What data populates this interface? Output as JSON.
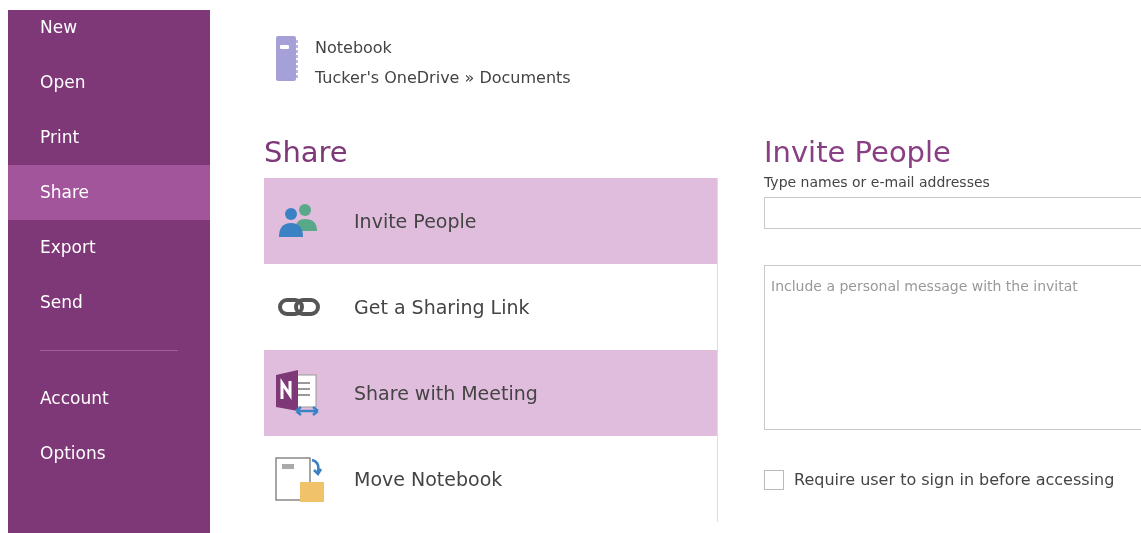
{
  "sidebar": {
    "items": [
      {
        "label": "New",
        "selected": false
      },
      {
        "label": "Open",
        "selected": false
      },
      {
        "label": "Print",
        "selected": false
      },
      {
        "label": "Share",
        "selected": true
      },
      {
        "label": "Export",
        "selected": false
      },
      {
        "label": "Send",
        "selected": false
      },
      {
        "kind": "divider"
      },
      {
        "label": "Account",
        "selected": false
      },
      {
        "label": "Options",
        "selected": false
      }
    ]
  },
  "notebook": {
    "name": "Notebook",
    "location": "Tucker's OneDrive » Documents"
  },
  "share": {
    "title": "Share",
    "options": [
      {
        "kind": "people",
        "label": "Invite People",
        "highlighted": true
      },
      {
        "kind": "link",
        "label": "Get a Sharing Link",
        "highlighted": false
      },
      {
        "kind": "meeting",
        "label": "Share with Meeting",
        "highlighted": true
      },
      {
        "kind": "move",
        "label": "Move Notebook",
        "highlighted": false
      }
    ]
  },
  "invite": {
    "title": "Invite People",
    "names_label": "Type names or e-mail addresses",
    "message": {
      "placeholder": "Include a personal message with the invitat"
    },
    "require_sign_in": {
      "label": "Require user to sign in before accessing",
      "checked": false
    }
  }
}
